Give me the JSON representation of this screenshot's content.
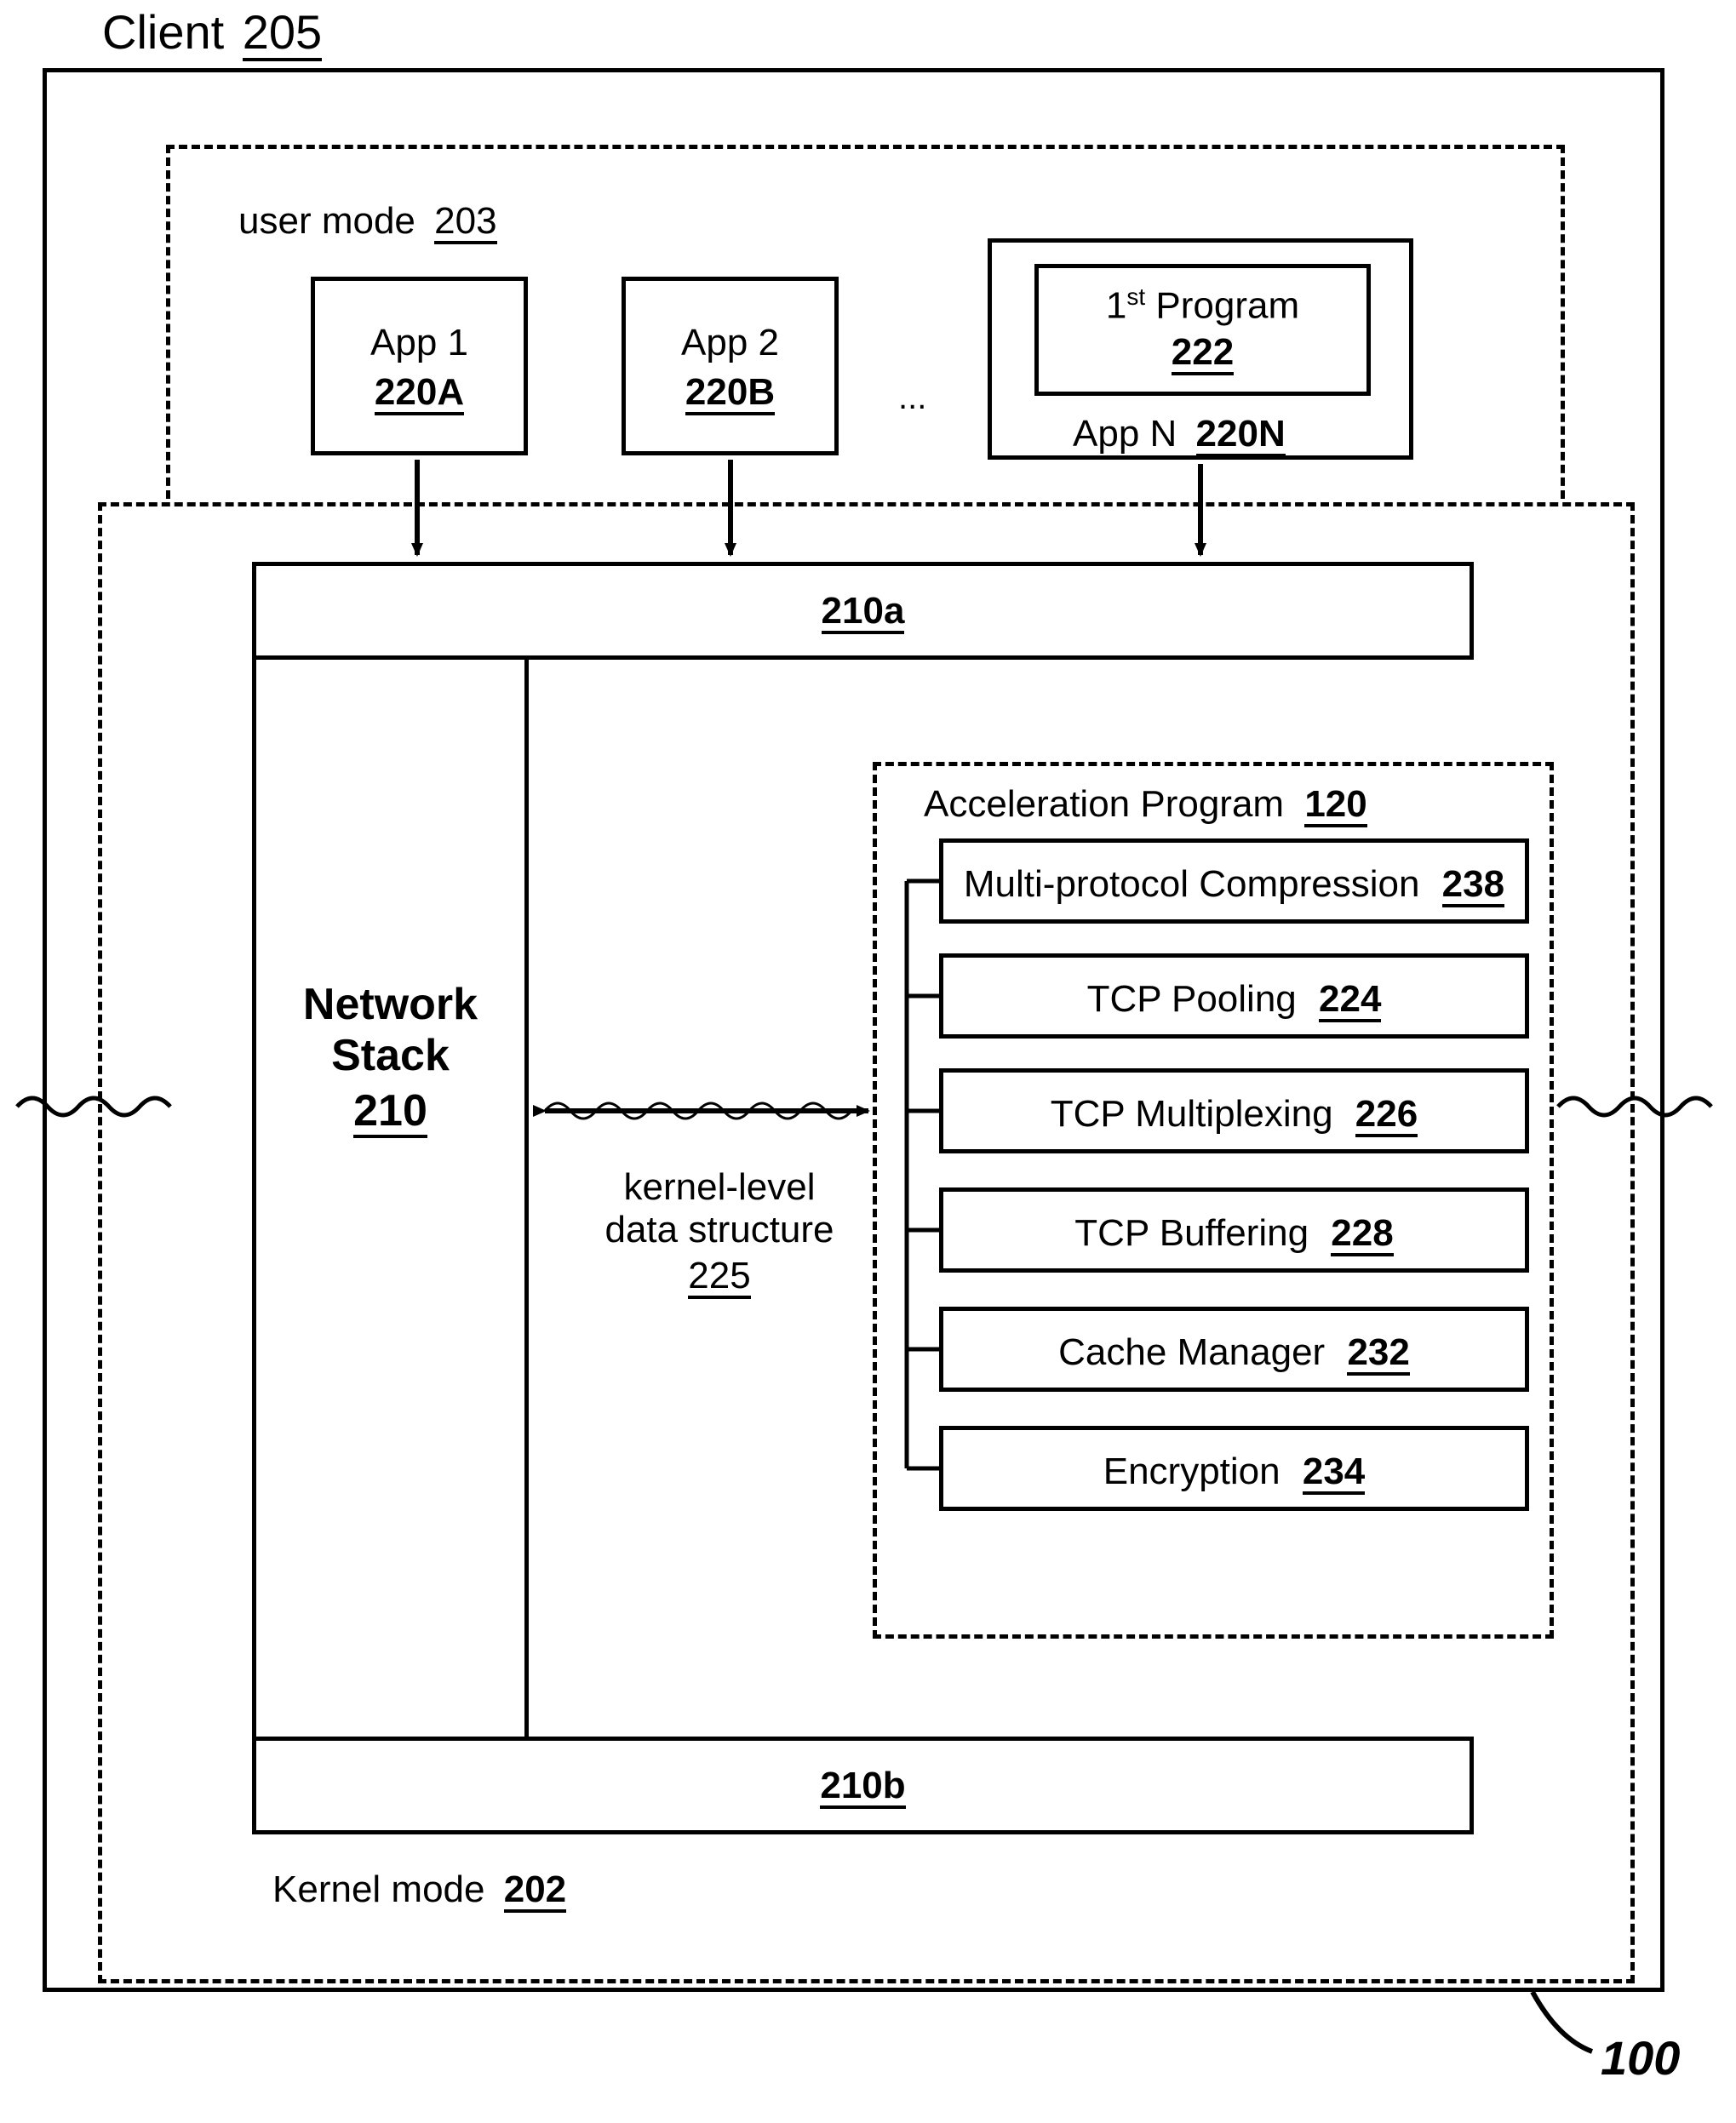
{
  "title": {
    "label": "Client",
    "ref": "205"
  },
  "userMode": {
    "label": "user mode",
    "ref": "203"
  },
  "kernelMode": {
    "label": "Kernel mode",
    "ref": "202"
  },
  "apps": {
    "a1": {
      "name": "App 1",
      "ref": "220A"
    },
    "a2": {
      "name": "App 2",
      "ref": "220B"
    },
    "dots": "...",
    "aNouter": {
      "name": "App N",
      "ref": "220N"
    },
    "innerProgram": {
      "name": "1",
      "suffix": " Program",
      "ord": "st",
      "ref": "222"
    }
  },
  "layer_top": {
    "ref": "210a"
  },
  "layer_bot": {
    "ref": "210b"
  },
  "networkStack": {
    "line1": "Network",
    "line2": "Stack",
    "ref": "210"
  },
  "kernelData": {
    "line1": "kernel-level",
    "line2": "data structure",
    "ref": "225"
  },
  "accel": {
    "title": "Acceleration Program",
    "ref": "120",
    "items": [
      {
        "name": "Multi-protocol Compression",
        "ref": "238"
      },
      {
        "name": "TCP Pooling",
        "ref": "224"
      },
      {
        "name": "TCP Multiplexing",
        "ref": "226"
      },
      {
        "name": "TCP Buffering",
        "ref": "228"
      },
      {
        "name": "Cache Manager",
        "ref": "232"
      },
      {
        "name": "Encryption",
        "ref": "234"
      }
    ]
  },
  "figureRef": "100"
}
